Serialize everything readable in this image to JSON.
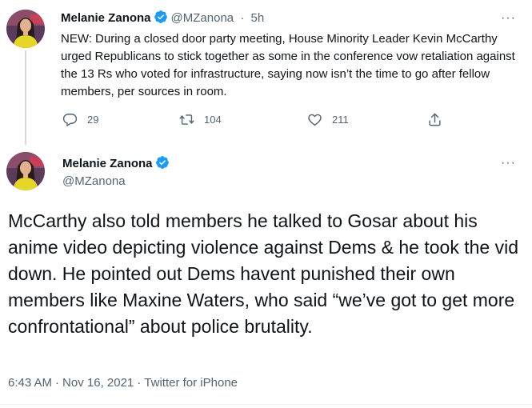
{
  "tweet1": {
    "name": "Melanie Zanona",
    "handle": "@MZanona",
    "separator": "·",
    "time": "5h",
    "text": "NEW: During a closed door party meeting, House Minority Leader Kevin McCarthy urged Republicans to stick together as some in the conference vow retaliation against the 13 Rs who voted for infrastructure, saying now isn’t the time to go after fellow members, per sources in room.",
    "replies": "29",
    "retweets": "104",
    "likes": "211",
    "more": "···"
  },
  "tweet2": {
    "name": "Melanie Zanona",
    "handle": "@MZanona",
    "text": "McCarthy also told members he talked to Gosar about his anime video depicting violence against Dems & he took the vid down. He pointed out Dems havent punished their own members like Maxine Waters, who said “we’ve got to get more confrontational” about police brutality.",
    "time": "6:43 AM",
    "date": "Nov 16, 2021",
    "source": "Twitter for iPhone",
    "separator": "·",
    "more": "···"
  },
  "icons": {
    "verified": "verified-badge-icon",
    "reply": "reply-icon",
    "retweet": "retweet-icon",
    "like": "heart-icon",
    "share": "share-icon",
    "more": "more-icon"
  },
  "colors": {
    "verified": "#1d9bf0",
    "secondary_text": "#536471",
    "primary_text": "#0f1419",
    "thread_line": "#cfd9de"
  }
}
